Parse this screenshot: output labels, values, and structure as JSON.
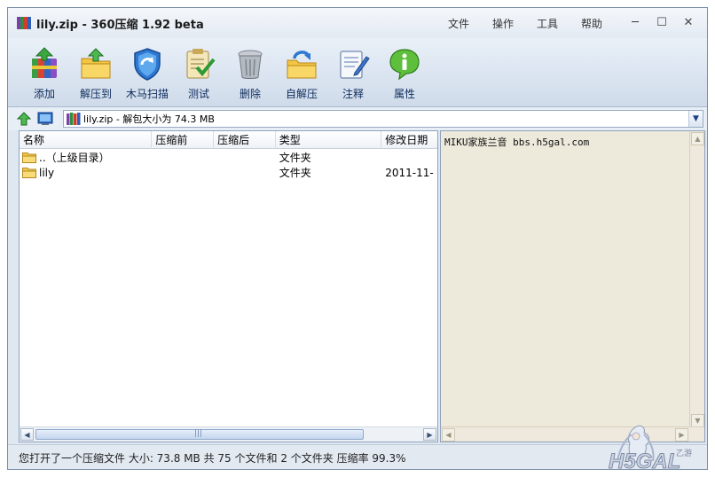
{
  "window": {
    "title": "lily.zip - 360压缩 1.92 beta"
  },
  "menu": [
    "文件",
    "操作",
    "工具",
    "帮助"
  ],
  "window_controls": {
    "minimize": "─",
    "maximize": "☐",
    "close": "✕"
  },
  "toolbar": [
    {
      "label": "添加",
      "icon": "add-archive-icon"
    },
    {
      "label": "解压到",
      "icon": "extract-to-icon"
    },
    {
      "label": "木马扫描",
      "icon": "trojan-scan-shield-icon"
    },
    {
      "label": "测试",
      "icon": "test-checklist-icon"
    },
    {
      "label": "删除",
      "icon": "delete-trash-icon"
    },
    {
      "label": "自解压",
      "icon": "self-extract-icon"
    },
    {
      "label": "注释",
      "icon": "comment-notepad-icon"
    },
    {
      "label": "属性",
      "icon": "info-properties-icon"
    }
  ],
  "address": {
    "path": "lily.zip - 解包大小为 74.3 MB"
  },
  "columns": [
    "名称",
    "压缩前",
    "压缩后",
    "类型",
    "修改日期"
  ],
  "files": [
    {
      "name": "..（上级目录）",
      "before": "",
      "after": "",
      "type": "文件夹",
      "modified": ""
    },
    {
      "name": "lily",
      "before": "",
      "after": "",
      "type": "文件夹",
      "modified": "2011-11-"
    }
  ],
  "scrollbar": {
    "thumb_grip": "|||"
  },
  "comment": "MIKU家族兰音 bbs.h5gal.com",
  "status": "您打开了一个压缩文件 大小: 73.8 MB 共 75 个文件和 2 个文件夹 压缩率 99.3%",
  "watermark": {
    "text": "H5GAL",
    "subtext": "乙游",
    "icon": "anime-mascot-watermark-icon"
  },
  "colors": {
    "toolbar_label": "#0d2a5c",
    "comment_bg": "#ede9db",
    "folder": "#f2c94c"
  }
}
